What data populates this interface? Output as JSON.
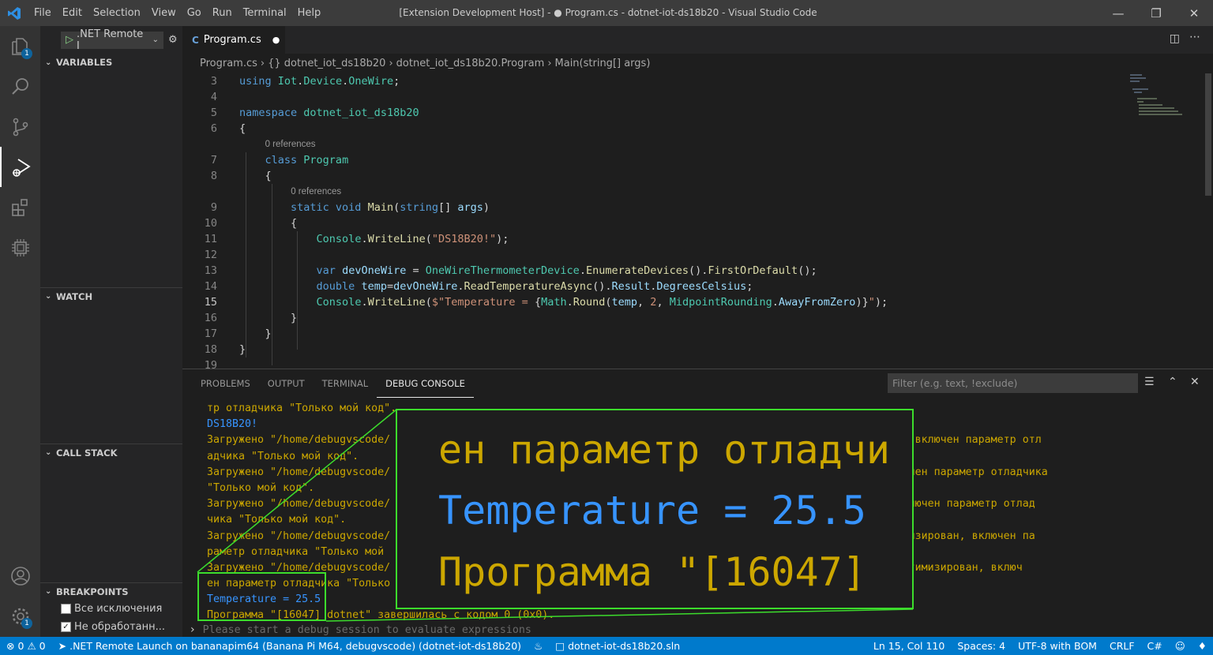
{
  "window": {
    "title": "[Extension Development Host] - ● Program.cs - dotnet-iot-ds18b20 - Visual Studio Code",
    "menu": [
      "File",
      "Edit",
      "Selection",
      "View",
      "Go",
      "Run",
      "Terminal",
      "Help"
    ]
  },
  "activity": {
    "explorer_badge": "1",
    "settings_badge": "1"
  },
  "sidebar": {
    "run_config": ".NET Remote I",
    "sections": {
      "variables": "VARIABLES",
      "watch": "WATCH",
      "call_stack": "CALL STACK",
      "breakpoints": "BREAKPOINTS"
    },
    "breakpoints": [
      {
        "label": "Все исключения",
        "checked": false
      },
      {
        "label": "Не обработанн...",
        "checked": true
      }
    ]
  },
  "editor": {
    "tab": "Program.cs",
    "breadcrumbs": [
      "Program.cs",
      "{} dotnet_iot_ds18b20",
      "dotnet_iot_ds18b20.Program",
      "Main(string[] args)"
    ],
    "lines": [
      {
        "n": "3",
        "segs": [
          [
            "kw",
            "using "
          ],
          [
            "cl",
            "Iot"
          ],
          [
            "pl",
            "."
          ],
          [
            "cl",
            "Device"
          ],
          [
            "pl",
            "."
          ],
          [
            "cl",
            "OneWire"
          ],
          [
            "pl",
            ";"
          ]
        ]
      },
      {
        "n": "4",
        "segs": []
      },
      {
        "n": "5",
        "segs": [
          [
            "kw",
            "namespace "
          ],
          [
            "cl",
            "dotnet_iot_ds18b20"
          ]
        ]
      },
      {
        "n": "6",
        "segs": [
          [
            "pl",
            "{"
          ]
        ]
      },
      {
        "lens": "0 references",
        "indent": 4
      },
      {
        "n": "7",
        "segs": [
          [
            "pl",
            "    "
          ],
          [
            "kw",
            "class "
          ],
          [
            "cl",
            "Program"
          ]
        ]
      },
      {
        "n": "8",
        "segs": [
          [
            "pl",
            "    {"
          ]
        ]
      },
      {
        "lens": "0 references",
        "indent": 8
      },
      {
        "n": "9",
        "segs": [
          [
            "pl",
            "        "
          ],
          [
            "kw",
            "static void "
          ],
          [
            "fn",
            "Main"
          ],
          [
            "pl",
            "("
          ],
          [
            "kw",
            "string"
          ],
          [
            "pl",
            "[] "
          ],
          [
            "vr",
            "args"
          ],
          [
            "pl",
            ")"
          ]
        ]
      },
      {
        "n": "10",
        "segs": [
          [
            "pl",
            "        {"
          ]
        ]
      },
      {
        "n": "11",
        "segs": [
          [
            "pl",
            "            "
          ],
          [
            "cl",
            "Console"
          ],
          [
            "pl",
            "."
          ],
          [
            "fn",
            "WriteLine"
          ],
          [
            "pl",
            "("
          ],
          [
            "st",
            "\"DS18B20!\""
          ],
          [
            "pl",
            ");"
          ]
        ]
      },
      {
        "n": "12",
        "segs": []
      },
      {
        "n": "13",
        "segs": [
          [
            "pl",
            "            "
          ],
          [
            "kw",
            "var "
          ],
          [
            "vr",
            "devOneWire"
          ],
          [
            "pl",
            " = "
          ],
          [
            "cl",
            "OneWireThermometerDevice"
          ],
          [
            "pl",
            "."
          ],
          [
            "fn",
            "EnumerateDevices"
          ],
          [
            "pl",
            "()."
          ],
          [
            "fn",
            "FirstOrDefault"
          ],
          [
            "pl",
            "();"
          ]
        ]
      },
      {
        "n": "14",
        "segs": [
          [
            "pl",
            "            "
          ],
          [
            "kw",
            "double "
          ],
          [
            "vr",
            "temp"
          ],
          [
            "pl",
            "="
          ],
          [
            "vr",
            "devOneWire"
          ],
          [
            "pl",
            "."
          ],
          [
            "fn",
            "ReadTemperatureAsync"
          ],
          [
            "pl",
            "()."
          ],
          [
            "vr",
            "Result"
          ],
          [
            "pl",
            "."
          ],
          [
            "vr",
            "DegreesCelsius"
          ],
          [
            "pl",
            ";"
          ]
        ]
      },
      {
        "n": "15",
        "segs": [
          [
            "pl",
            "            "
          ],
          [
            "cl",
            "Console"
          ],
          [
            "pl",
            "."
          ],
          [
            "fn",
            "WriteLine"
          ],
          [
            "pl",
            "("
          ],
          [
            "st",
            "$\"Temperature = "
          ],
          [
            "pl",
            "{"
          ],
          [
            "cl",
            "Math"
          ],
          [
            "pl",
            "."
          ],
          [
            "fn",
            "Round"
          ],
          [
            "pl",
            "("
          ],
          [
            "vr",
            "temp"
          ],
          [
            "pl",
            ", "
          ],
          [
            "st",
            "2"
          ],
          [
            "pl",
            ", "
          ],
          [
            "cl",
            "MidpointRounding"
          ],
          [
            "pl",
            "."
          ],
          [
            "vr",
            "AwayFromZero"
          ],
          [
            "pl",
            ")}"
          ],
          [
            "st",
            "\""
          ],
          [
            "pl",
            ");"
          ]
        ]
      },
      {
        "n": "16",
        "segs": [
          [
            "pl",
            "        }"
          ]
        ]
      },
      {
        "n": "17",
        "segs": [
          [
            "pl",
            "    }"
          ]
        ]
      },
      {
        "n": "18",
        "segs": [
          [
            "pl",
            "}"
          ]
        ]
      },
      {
        "n": "19",
        "segs": []
      }
    ]
  },
  "panel": {
    "tabs": [
      "PROBLEMS",
      "OUTPUT",
      "TERMINAL",
      "DEBUG CONSOLE"
    ],
    "filter_placeholder": "Filter (e.g. text, !exclude)",
    "console": [
      {
        "t": "тр отладчика \"Только мой код\".",
        "c": "y"
      },
      {
        "t": "DS18B20!",
        "c": "b"
      },
      {
        "t": "Загружено \"/home/debugvscode/                                                           . Модуль оптимизирован, включен параметр отл",
        "c": "y"
      },
      {
        "t": "адчика \"Только мой код\".",
        "c": "y"
      },
      {
        "t": "Загружено \"/home/debugvscode/                                                            ль оптимизирован, включен параметр отладчика",
        "c": "y"
      },
      {
        "t": "\"Только мой код\".",
        "c": "y"
      },
      {
        "t": "Загружено \"/home/debugvscode/                                                          Модуль оптимизирован, включен параметр отлад",
        "c": "y"
      },
      {
        "t": "чика \"Только мой код\".",
        "c": "y"
      },
      {
        "t": "Загружено \"/home/debugvscode/                                                         в пропущена. Модуль оптимизирован, включен па",
        "c": "y"
      },
      {
        "t": "раметр отладчика \"Только мой",
        "c": "y"
      },
      {
        "t": "Загружено \"/home/debugvscode/                                                      имволов пропущена. Модуль оптимизирован, включ",
        "c": "y"
      },
      {
        "t": "ен параметр отладчика \"Только",
        "c": "y"
      },
      {
        "t": "Temperature = 25.5",
        "c": "b"
      },
      {
        "t": "Программа \"[16047] dotnet\" завершилась с кодом 0 (0x0).",
        "c": "y"
      }
    ],
    "prompt_placeholder": "Please start a debug session to evaluate expressions"
  },
  "zoom": {
    "line1": "ен параметр отладчи",
    "line2": "Temperature = 25.5",
    "line3": "Программа \"[16047]"
  },
  "status": {
    "errors": "0",
    "warnings": "0",
    "launch": ".NET Remote Launch on bananapim64 (Banana Pi M64, debugvscode) (dotnet-iot-ds18b20)",
    "solution": "dotnet-iot-ds18b20.sln",
    "position": "Ln 15, Col 110",
    "spaces": "Spaces: 4",
    "encoding": "UTF-8 with BOM",
    "eol": "CRLF",
    "language": "C#"
  },
  "colors": {
    "accent": "#007acc",
    "highlight": "#3cdc2c",
    "console_warn": "#cca700",
    "console_info": "#3794ff"
  }
}
